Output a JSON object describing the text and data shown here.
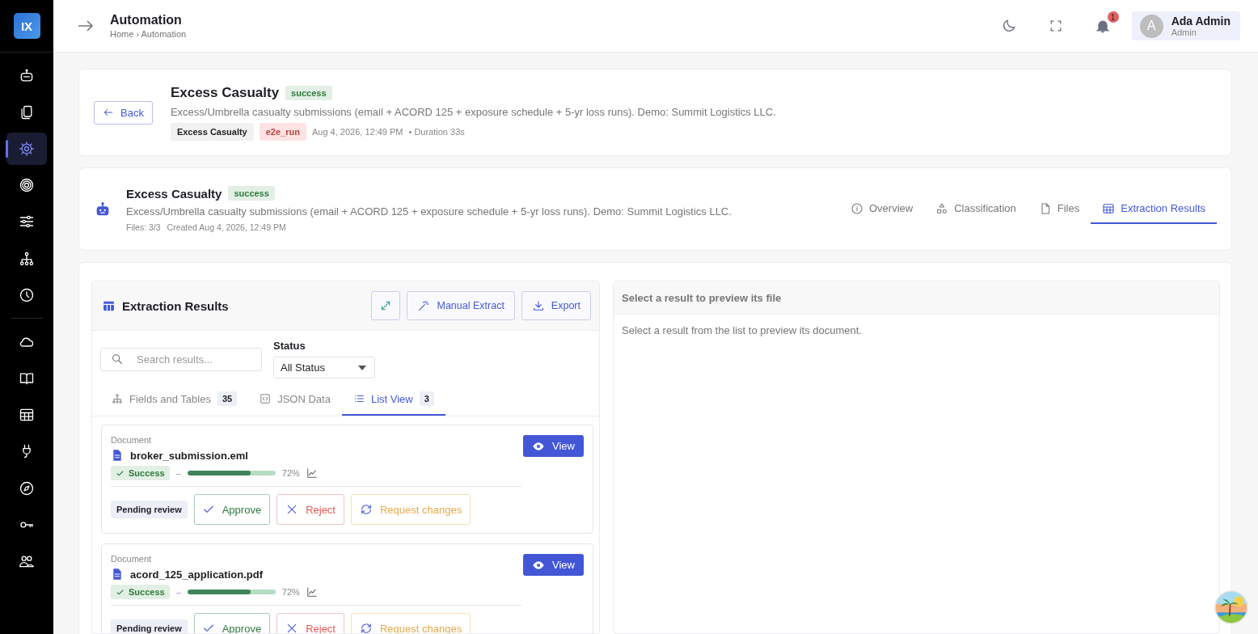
{
  "logo": "IX",
  "sidebar": {
    "groups": [
      {
        "items": [
          {
            "selected": false
          },
          {
            "selected": false
          },
          {
            "selected": true
          },
          {
            "selected": false
          },
          {
            "selected": false
          },
          {
            "selected": false
          },
          {
            "selected": false
          }
        ]
      },
      {
        "items": [
          {
            "selected": false
          },
          {
            "selected": false
          },
          {
            "selected": false
          },
          {
            "selected": false
          },
          {
            "selected": false
          },
          {
            "selected": false
          },
          {
            "selected": false
          }
        ]
      }
    ]
  },
  "header": {
    "title": "Automation",
    "breadcrumb": "Home › Automation",
    "notifications": "1",
    "user": {
      "initial": "A",
      "name": "Ada Admin",
      "role": "Admin"
    }
  },
  "run": {
    "back": "Back",
    "title": "Excess Casualty",
    "status": "success",
    "description": "Excess/Umbrella casualty submissions (email + ACORD 125 + exposure schedule + 5-yr loss runs). Demo: Summit Logistics LLC.",
    "tags": [
      {
        "label": "Excess Casualty",
        "kind": "neutral"
      },
      {
        "label": "e2e_run",
        "kind": "danger"
      }
    ],
    "time": "Aug 4, 2026, 12:49 PM",
    "duration": "• Duration 33s"
  },
  "automation": {
    "title": "Excess Casualty",
    "status": "success",
    "description": "Excess/Umbrella casualty submissions (email + ACORD 125 + exposure schedule + 5-yr loss runs). Demo: Summit Logistics LLC.",
    "files": "Files: 3/3",
    "created": "Created Aug 4, 2026, 12:49 PM",
    "tabs": [
      {
        "label": "Overview",
        "selected": false
      },
      {
        "label": "Classification",
        "selected": false
      },
      {
        "label": "Files",
        "selected": false
      },
      {
        "label": "Extraction Results",
        "selected": true
      }
    ]
  },
  "results": {
    "title": "Extraction Results",
    "buttons": [
      {
        "label": "Manual Extract"
      },
      {
        "label": "Export"
      }
    ],
    "search": {
      "placeholder": "Search results..."
    },
    "status_label": "Status",
    "status_value": "All Status",
    "view_tabs": [
      {
        "label": "Fields and Tables",
        "count": "35",
        "selected": false
      },
      {
        "label": "JSON Data",
        "selected": false
      },
      {
        "label": "List View",
        "count": "3",
        "selected": true
      }
    ],
    "documents": [
      {
        "type_label": "Document",
        "name": "broker_submission.eml",
        "status": "Success",
        "dash": "–",
        "level": 0.72,
        "percent": "72%",
        "review": "Pending review",
        "view": "View",
        "actions": [
          {
            "label": "Approve",
            "kind": "approve"
          },
          {
            "label": "Reject",
            "kind": "reject"
          },
          {
            "label": "Request changes",
            "kind": "request"
          }
        ]
      },
      {
        "type_label": "Document",
        "name": "acord_125_application.pdf",
        "status": "Success",
        "dash": "–",
        "level": 0.72,
        "percent": "72%",
        "review": "Pending review",
        "view": "View",
        "actions": [
          {
            "label": "Approve",
            "kind": "approve"
          },
          {
            "label": "Reject",
            "kind": "reject"
          },
          {
            "label": "Request changes",
            "kind": "request"
          }
        ]
      }
    ]
  },
  "preview": {
    "title": "Select a result to preview its file",
    "message": "Select a result from the list to preview its document."
  }
}
